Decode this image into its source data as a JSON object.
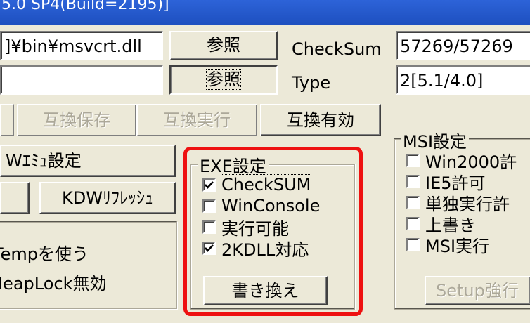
{
  "window": {
    "title": "5.0 SP4(Build=2195)]"
  },
  "top": {
    "path_value": "]¥bin¥msvcrt.dll",
    "path2_value": "",
    "browse_label": "参照",
    "browse2_label": "参照",
    "checksum_label": "CheckSum",
    "checksum_value": "57269/57269",
    "type_label": "Type",
    "type_value": "2[5.1/4.0]"
  },
  "compat": {
    "save_label": "互換保存",
    "run_label": "互換実行",
    "enable_label": "互換有効"
  },
  "left": {
    "w_emu_label": "Wｴﾐｭ設定",
    "kdw_refresh_label": "KDWﾘﾌﾚｯｼｭ",
    "temp_label": "Tempを使う",
    "heaplock_label": "HeapLock無効"
  },
  "exe": {
    "legend": "EXE設定",
    "items": [
      {
        "label": "CheckSUM",
        "checked": true
      },
      {
        "label": "WinConsole",
        "checked": false
      },
      {
        "label": "実行可能",
        "checked": false
      },
      {
        "label": "2KDLL対応",
        "checked": true
      }
    ],
    "rewrite_label": "書き換え"
  },
  "msi": {
    "legend": "MSI設定",
    "items": [
      {
        "label": "Win2000許",
        "checked": false
      },
      {
        "label": "IE5許可",
        "checked": false
      },
      {
        "label": "単独実行許",
        "checked": false
      },
      {
        "label": "上書き",
        "checked": false
      },
      {
        "label": "MSI実行",
        "checked": false
      }
    ],
    "setup_label": "Setup強行"
  },
  "colors": {
    "highlight": "#ee1111",
    "titlebar": "#2d63d8",
    "face": "#ece9d8"
  }
}
